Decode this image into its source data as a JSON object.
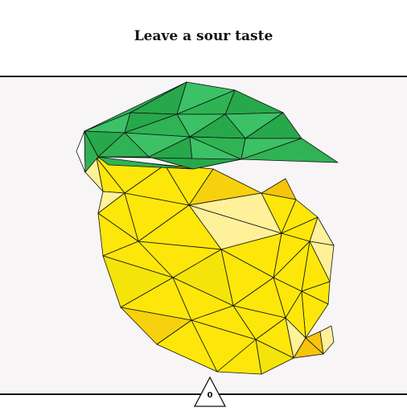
{
  "header": {
    "title": "Leave a sour taste"
  },
  "counter": {
    "value": "0",
    "icon": "triangle-icon"
  },
  "colors": {
    "leaf_dark": "#27a84a",
    "leaf_light": "#3cc166",
    "lemon_yellow": "#fde70a",
    "lemon_light": "#fff09a",
    "lemon_orange": "#f7c30d",
    "outline": "#111111"
  }
}
